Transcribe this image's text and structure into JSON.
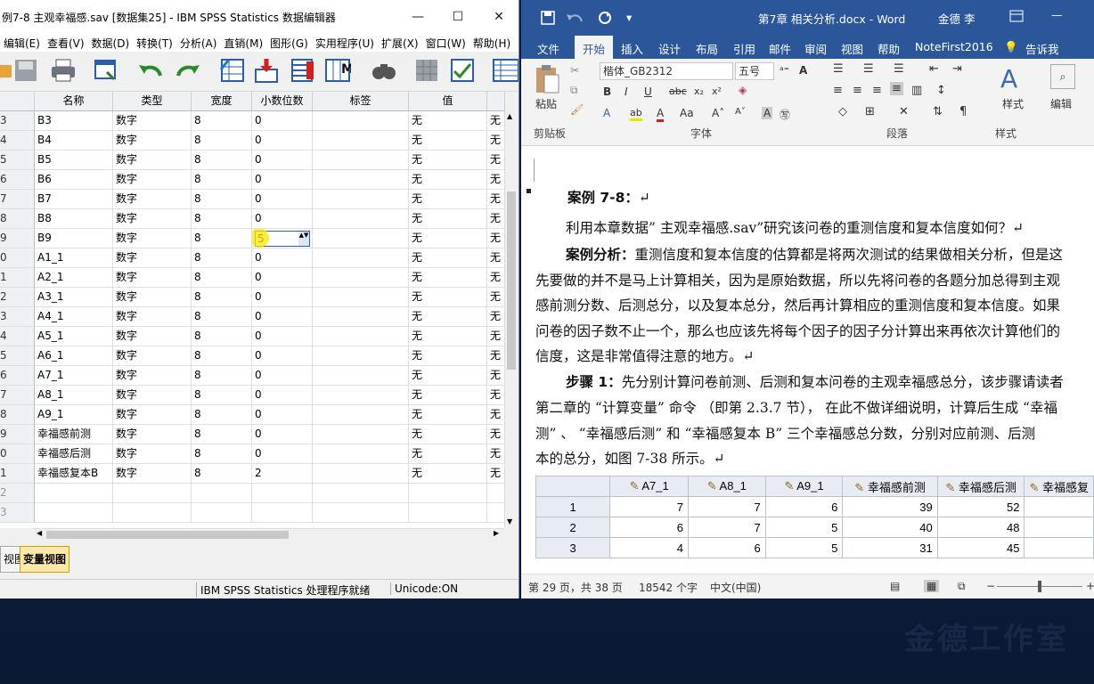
{
  "spss": {
    "title": "例7-8 主观幸福感.sav [数据集25] - IBM SPSS Statistics 数据编辑器",
    "window_controls": [
      "—",
      "☐",
      "✕"
    ],
    "menus": [
      "编辑(E)",
      "查看(V)",
      "数据(D)",
      "转换(T)",
      "分析(A)",
      "直销(M)",
      "图形(G)",
      "实用程序(U)",
      "扩展(X)",
      "窗口(W)",
      "帮助(H)"
    ],
    "toolbar": [
      "open-icon",
      "save-icon",
      "print-icon",
      "dialog-recall-icon",
      "undo-icon",
      "redo-icon",
      "goto-case-icon",
      "goto-variable-icon",
      "variables-icon",
      "value-labels-icon",
      "find-icon",
      "split-file-icon",
      "select-cases-icon",
      "grid-icon"
    ],
    "columns": [
      "名称",
      "类型",
      "宽度",
      "小数位数",
      "标签",
      "值"
    ],
    "rows": [
      {
        "n": "3",
        "name": "B3",
        "type": "数字",
        "width": "8",
        "dec": "0",
        "label": "",
        "val": "无",
        "extra": "无"
      },
      {
        "n": "4",
        "name": "B4",
        "type": "数字",
        "width": "8",
        "dec": "0",
        "label": "",
        "val": "无",
        "extra": "无"
      },
      {
        "n": "5",
        "name": "B5",
        "type": "数字",
        "width": "8",
        "dec": "0",
        "label": "",
        "val": "无",
        "extra": "无"
      },
      {
        "n": "6",
        "name": "B6",
        "type": "数字",
        "width": "8",
        "dec": "0",
        "label": "",
        "val": "无",
        "extra": "无"
      },
      {
        "n": "7",
        "name": "B7",
        "type": "数字",
        "width": "8",
        "dec": "0",
        "label": "",
        "val": "无",
        "extra": "无"
      },
      {
        "n": "8",
        "name": "B8",
        "type": "数字",
        "width": "8",
        "dec": "0",
        "label": "",
        "val": "无",
        "extra": "无"
      },
      {
        "n": "9",
        "name": "B9",
        "type": "数字",
        "width": "8",
        "dec": "5",
        "label": "",
        "val": "无",
        "extra": "无"
      },
      {
        "n": "0",
        "name": "A1_1",
        "type": "数字",
        "width": "8",
        "dec": "0",
        "label": "",
        "val": "无",
        "extra": "无"
      },
      {
        "n": "1",
        "name": "A2_1",
        "type": "数字",
        "width": "8",
        "dec": "0",
        "label": "",
        "val": "无",
        "extra": "无"
      },
      {
        "n": "2",
        "name": "A3_1",
        "type": "数字",
        "width": "8",
        "dec": "0",
        "label": "",
        "val": "无",
        "extra": "无"
      },
      {
        "n": "3",
        "name": "A4_1",
        "type": "数字",
        "width": "8",
        "dec": "0",
        "label": "",
        "val": "无",
        "extra": "无"
      },
      {
        "n": "4",
        "name": "A5_1",
        "type": "数字",
        "width": "8",
        "dec": "0",
        "label": "",
        "val": "无",
        "extra": "无"
      },
      {
        "n": "5",
        "name": "A6_1",
        "type": "数字",
        "width": "8",
        "dec": "0",
        "label": "",
        "val": "无",
        "extra": "无"
      },
      {
        "n": "6",
        "name": "A7_1",
        "type": "数字",
        "width": "8",
        "dec": "0",
        "label": "",
        "val": "无",
        "extra": "无"
      },
      {
        "n": "7",
        "name": "A8_1",
        "type": "数字",
        "width": "8",
        "dec": "0",
        "label": "",
        "val": "无",
        "extra": "无"
      },
      {
        "n": "8",
        "name": "A9_1",
        "type": "数字",
        "width": "8",
        "dec": "0",
        "label": "",
        "val": "无",
        "extra": "无"
      },
      {
        "n": "9",
        "name": "幸福感前测",
        "type": "数字",
        "width": "8",
        "dec": "0",
        "label": "",
        "val": "无",
        "extra": "无"
      },
      {
        "n": "0",
        "name": "幸福感后测",
        "type": "数字",
        "width": "8",
        "dec": "0",
        "label": "",
        "val": "无",
        "extra": "无"
      },
      {
        "n": "1",
        "name": "幸福感复本B",
        "type": "数字",
        "width": "8",
        "dec": "2",
        "label": "",
        "val": "无",
        "extra": "无"
      },
      {
        "n": "2",
        "name": "",
        "type": "",
        "width": "",
        "dec": "",
        "label": "",
        "val": "",
        "extra": ""
      },
      {
        "n": "3",
        "name": "",
        "type": "",
        "width": "",
        "dec": "",
        "label": "",
        "val": "",
        "extra": ""
      }
    ],
    "editing_cell_value": "5",
    "tabs": [
      "视图",
      "变量视图"
    ],
    "status_text": "IBM SPSS Statistics 处理程序就绪",
    "unicode_status": "Unicode:ON"
  },
  "word": {
    "title": "第7章 相关分析.docx - Word",
    "user": "金德 李",
    "tabs": [
      "文件",
      "开始",
      "插入",
      "设计",
      "布局",
      "引用",
      "邮件",
      "审阅",
      "视图",
      "帮助",
      "NoteFirst2016",
      "告诉我"
    ],
    "font_name": "楷体_GB2312",
    "font_size": "五号",
    "groups": {
      "clipboard": "剪贴板",
      "font": "字体",
      "paragraph": "段落",
      "styles": "样式"
    },
    "paste": "粘贴",
    "styles_btn": "样式",
    "edit_btn": "编辑",
    "doc_lines": [
      {
        "bold": "案例 7-8：",
        "text": "↵"
      },
      {
        "bold": "",
        "text": "利用本章数据” 主观幸福感.sav”研究该问卷的重测信度和复本信度如何？↵"
      },
      {
        "bold": "案例分析：",
        "text": "重测信度和复本信度的估算都是将两次测试的结果做相关分析，但是这"
      },
      {
        "bold": "",
        "text": "先要做的并不是马上计算相关，因为是原始数据，所以先将问卷的各题分加总得到主观"
      },
      {
        "bold": "",
        "text": "感前测分数、后测总分，以及复本总分，然后再计算相应的重测信度和复本信度。如果"
      },
      {
        "bold": "",
        "text": "问卷的因子数不止一个，那么也应该先将每个因子的因子分计算出来再依次计算他们的"
      },
      {
        "bold": "",
        "text": "信度，这是非常值得注意的地方。↵"
      },
      {
        "bold": "步骤 1：",
        "text": "先分别计算问卷前测、后测和复本问卷的主观幸福感总分，该步骤请读者"
      },
      {
        "bold": "",
        "text": "第二章的 “计算变量” 命令 （即第 2.3.7 节）， 在此不做详细说明，计算后生成 “幸福"
      },
      {
        "bold": "",
        "text": "测” 、 “幸福感后测” 和 “幸福感复本 B” 三个幸福感总分数，分别对应前测、后测"
      },
      {
        "bold": "",
        "text": "本的总分，如图 7-38 所示。↵"
      }
    ],
    "table": {
      "headers": [
        "",
        "A7_1",
        "A8_1",
        "A9_1",
        "幸福感前测",
        "幸福感后测",
        "幸福感复"
      ],
      "rows": [
        [
          "1",
          "7",
          "7",
          "6",
          "39",
          "52",
          ""
        ],
        [
          "2",
          "6",
          "7",
          "5",
          "40",
          "48",
          ""
        ],
        [
          "3",
          "4",
          "6",
          "5",
          "31",
          "45",
          ""
        ]
      ]
    },
    "status": {
      "page": "第 29 页，共 38 页",
      "words": "18542 个字",
      "lang": "中文(中国)"
    }
  },
  "watermark": "金德工作室"
}
